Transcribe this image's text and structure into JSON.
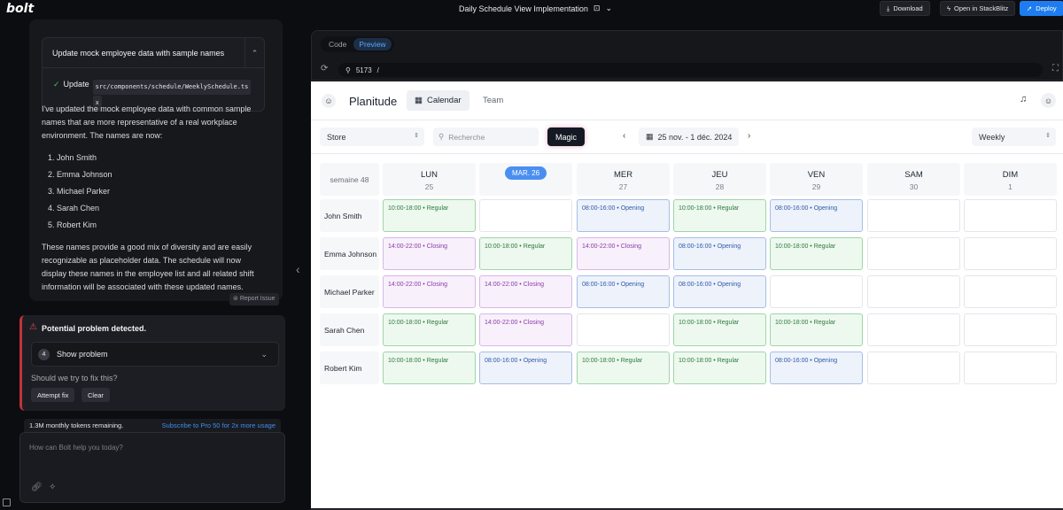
{
  "topbar": {
    "logo": "bolt",
    "project_title": "Daily Schedule View Implementation",
    "download": "Download",
    "open_stackblitz": "Open in StackBlitz",
    "deploy": "Deploy"
  },
  "chat": {
    "card_title": "Update mock employee data with sample names",
    "update_label": "Update",
    "update_file": "src/components/schedule/WeeklySchedule.ts",
    "update_file_tail": "x",
    "intro": "I've updated the mock employee data with common sample names that are more representative of a real workplace environment. The names are now:",
    "names": [
      "1. John Smith",
      "2. Emma Johnson",
      "3. Michael Parker",
      "4. Sarah Chen",
      "5. Robert Kim"
    ],
    "outro": "These names provide a good mix of diversity and are easily recognizable as placeholder data. The schedule will now display these names in the employee list and all related shift information will be associated with these updated names.",
    "report_issue": "Report Issue"
  },
  "problem": {
    "title": "Potential problem detected.",
    "count": "4",
    "show_problem": "Show problem",
    "question": "Should we try to fix this?",
    "attempt_fix": "Attempt fix",
    "clear": "Clear"
  },
  "tokens": {
    "remaining": "1.3M monthly tokens remaining.",
    "subscribe": "Subscribe to Pro 50 for 2x more usage"
  },
  "input": {
    "placeholder": "How can Bolt help you today?"
  },
  "preview": {
    "tabs": [
      "Code",
      "Preview"
    ],
    "port": "5173",
    "path": "/"
  },
  "app": {
    "brand": "Planitude",
    "tab_calendar": "Calendar",
    "tab_team": "Team",
    "store_select": "Store",
    "search_placeholder": "Recherche",
    "magic": "Magic",
    "date_range": "25 nov. - 1 déc. 2024",
    "view_select": "Weekly",
    "week_label": "semaine 48",
    "days": [
      {
        "name": "LUN",
        "num": "25"
      },
      {
        "name": "MAR. 26",
        "num": ""
      },
      {
        "name": "MER",
        "num": "27"
      },
      {
        "name": "JEU",
        "num": "28"
      },
      {
        "name": "VEN",
        "num": "29"
      },
      {
        "name": "SAM",
        "num": "30"
      },
      {
        "name": "DIM",
        "num": "1"
      }
    ],
    "employees": [
      {
        "name": "John Smith",
        "shifts": [
          "10:00-18:00 • Regular",
          "",
          "08:00-16:00 • Opening",
          "10:00-18:00 • Regular",
          "08:00-16:00 • Opening",
          "",
          ""
        ]
      },
      {
        "name": "Emma Johnson",
        "shifts": [
          "14:00-22:00 • Closing",
          "10:00-18:00 • Regular",
          "14:00-22:00 • Closing",
          "08:00-16:00 • Opening",
          "10:00-18:00 • Regular",
          "",
          ""
        ]
      },
      {
        "name": "Michael Parker",
        "shifts": [
          "14:00-22:00 • Closing",
          "14:00-22:00 • Closing",
          "08:00-16:00 • Opening",
          "08:00-16:00 • Opening",
          "",
          "",
          ""
        ]
      },
      {
        "name": "Sarah Chen",
        "shifts": [
          "10:00-18:00 • Regular",
          "14:00-22:00 • Closing",
          "",
          "10:00-18:00 • Regular",
          "10:00-18:00 • Regular",
          "",
          ""
        ]
      },
      {
        "name": "Robert Kim",
        "shifts": [
          "10:00-18:00 • Regular",
          "08:00-16:00 • Opening",
          "10:00-18:00 • Regular",
          "10:00-18:00 • Regular",
          "08:00-16:00 • Opening",
          "",
          ""
        ]
      }
    ]
  },
  "colors": {
    "accent": "#1d7df0",
    "regular": "#2d7a3b",
    "closing": "#8a3ca7",
    "opening": "#2f5ba8",
    "warning": "#c2323a"
  }
}
